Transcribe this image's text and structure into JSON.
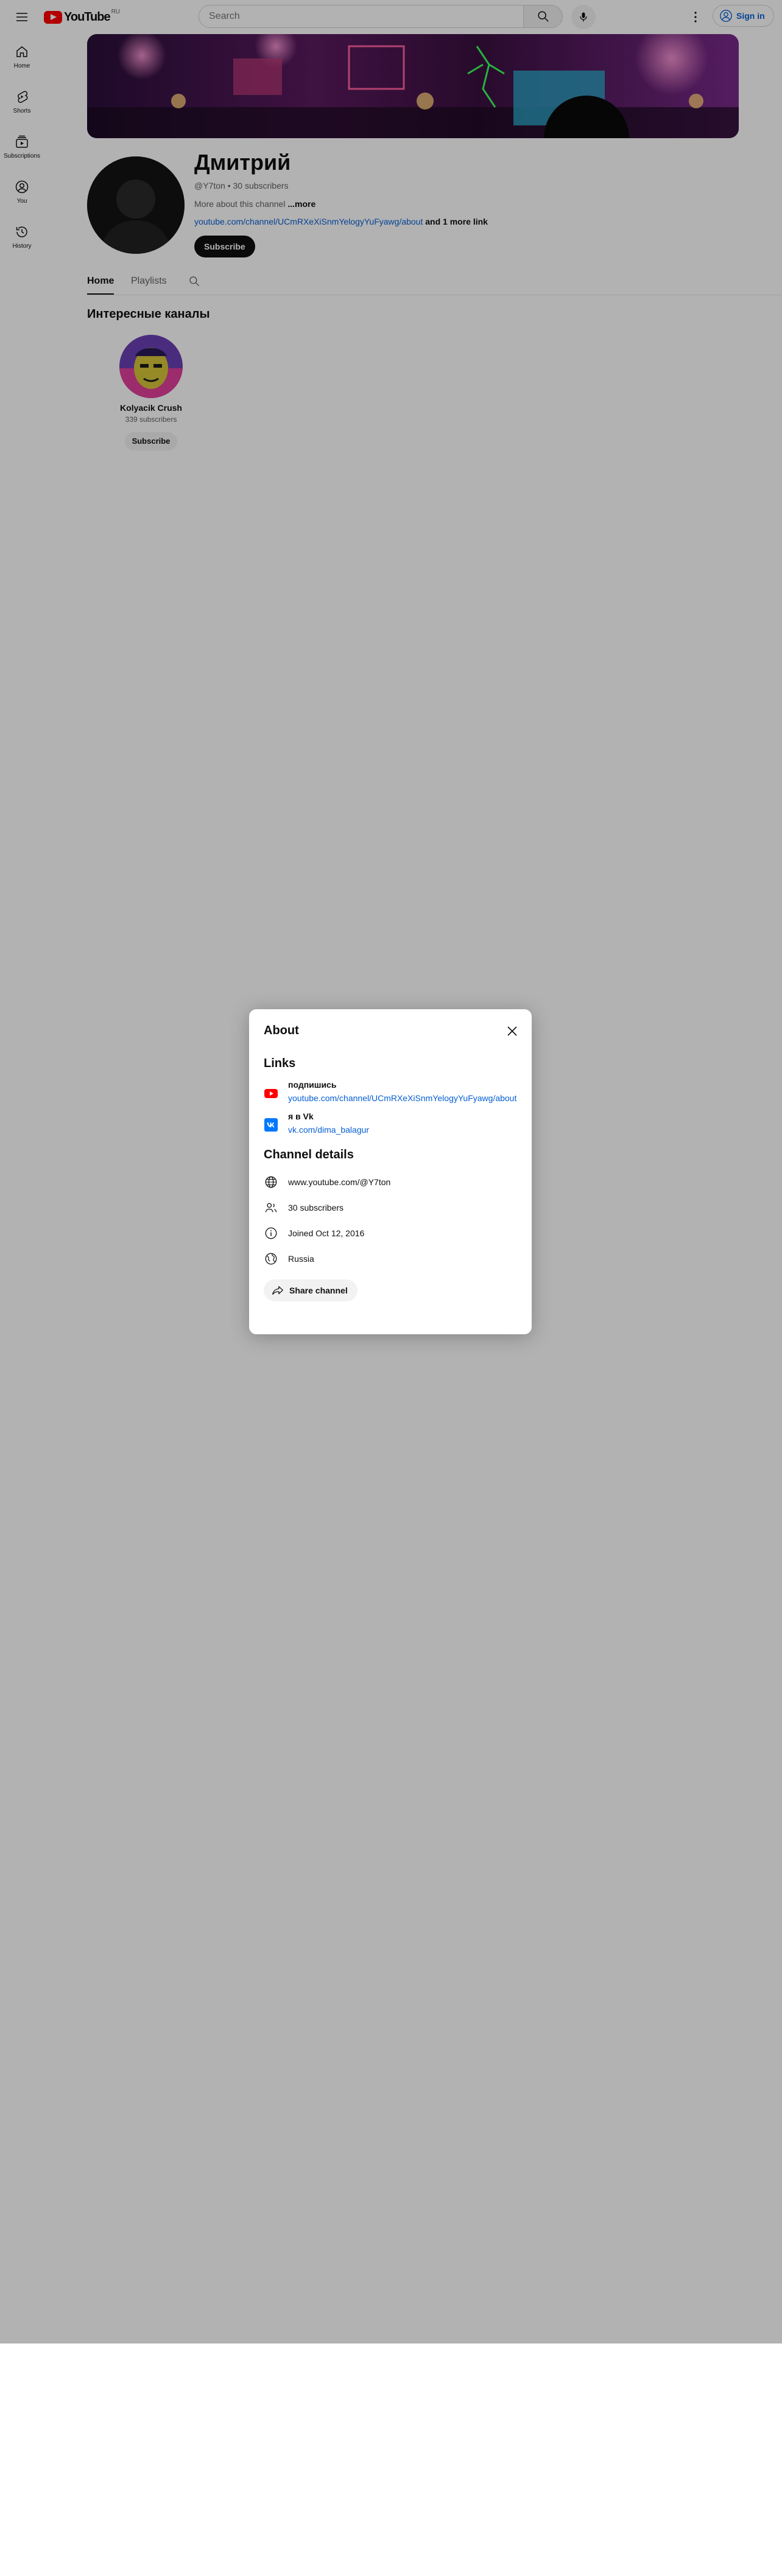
{
  "masthead": {
    "logo_text": "YouTube",
    "logo_country": "RU",
    "search_placeholder": "Search",
    "signin_label": "Sign in"
  },
  "guide": {
    "items": [
      {
        "label": "Home",
        "icon": "home-icon"
      },
      {
        "label": "Shorts",
        "icon": "shorts-icon"
      },
      {
        "label": "Subscriptions",
        "icon": "subscriptions-icon"
      },
      {
        "label": "You",
        "icon": "you-icon"
      },
      {
        "label": "History",
        "icon": "history-icon"
      }
    ]
  },
  "channel": {
    "name": "Дмитрий",
    "meta": "@Y7ton • 30 subscribers",
    "description": "More about this channel",
    "more_label": "...more",
    "link_text": "youtube.com/channel/UCmRXeXiSnmYelogyYuFyawg/about",
    "more_links": "and 1 more link",
    "subscribe_label": "Subscribe",
    "tabs": [
      "Home",
      "Playlists"
    ]
  },
  "featured": {
    "title": "Интересные каналы",
    "channels": [
      {
        "name": "Kolyacik Crush",
        "subscribers": "339 subscribers",
        "subscribe_label": "Subscribe"
      }
    ]
  },
  "about_dialog": {
    "title": "About",
    "links_heading": "Links",
    "links": [
      {
        "title": "подпишись",
        "url": "youtube.com/channel/UCmRXeXiSnmYelogyYuFyawg/about",
        "icon": "youtube-icon"
      },
      {
        "title": "я в Vk",
        "url": "vk.com/dima_balagur",
        "icon": "vk-icon"
      }
    ],
    "details_heading": "Channel details",
    "details": [
      {
        "text": "www.youtube.com/@Y7ton",
        "icon": "globe-icon"
      },
      {
        "text": "30 subscribers",
        "icon": "subscribers-icon"
      },
      {
        "text": "Joined Oct 12, 2016",
        "icon": "info-icon"
      },
      {
        "text": "Russia",
        "icon": "location-icon"
      }
    ],
    "share_label": "Share channel"
  },
  "colors": {
    "brand_red": "#ff0000",
    "link_blue": "#065fd4",
    "vk_blue": "#0077ff",
    "scrim": "rgba(0,0,0,0.30)"
  }
}
